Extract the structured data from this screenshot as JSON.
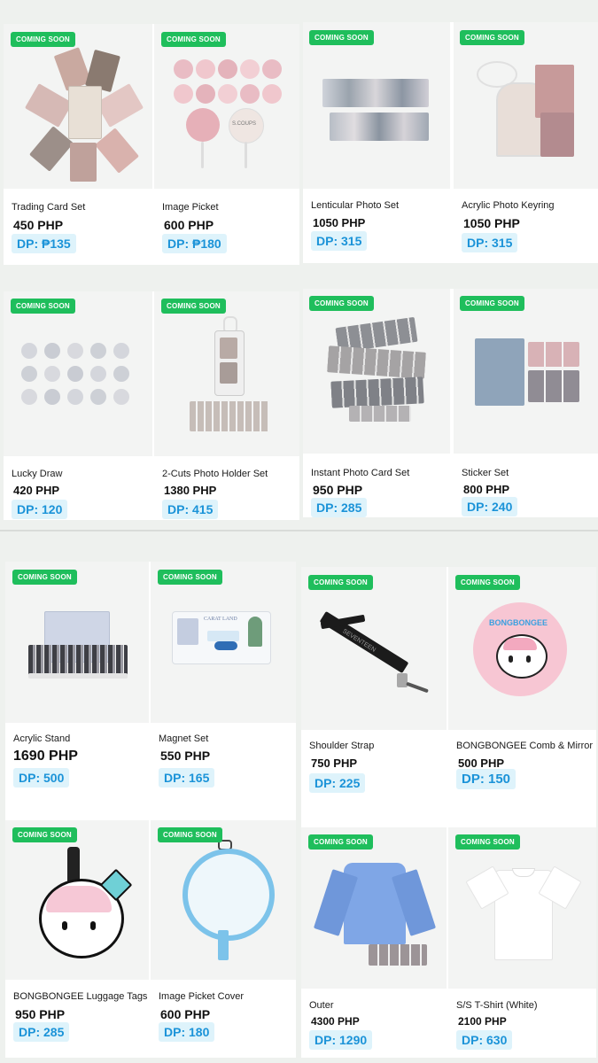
{
  "badge_label": "COMING SOON",
  "colors": {
    "badge": "#1fbe5c",
    "dp_bg": "#def3fb",
    "dp_text": "#1b93d8"
  },
  "products": [
    {
      "name": "Trading Card Set",
      "price": "450 PHP",
      "dp": "DP: ₱135"
    },
    {
      "name": "Image Picket",
      "price": "600 PHP",
      "dp": "DP: ₱180"
    },
    {
      "name": "Lenticular Photo Set",
      "price": "1050 PHP",
      "dp": "DP: 315"
    },
    {
      "name": "Acrylic Photo Keyring",
      "price": "1050 PHP",
      "dp": "DP: 315"
    },
    {
      "name": "Lucky Draw",
      "price": "420 PHP",
      "dp": "DP: 120"
    },
    {
      "name": "2-Cuts Photo Holder Set",
      "price": "1380 PHP",
      "dp": "DP: 415"
    },
    {
      "name": "Instant Photo Card Set",
      "price": "950 PHP",
      "dp": "DP: 285"
    },
    {
      "name": "Sticker Set",
      "price": "800 PHP",
      "dp": "DP: 240"
    },
    {
      "name": "Acrylic Stand",
      "price": "1690 PHP",
      "dp": "DP: 500"
    },
    {
      "name": "Magnet Set",
      "price": "550 PHP",
      "dp": "DP: 165"
    },
    {
      "name": "Shoulder Strap",
      "price": "750 PHP",
      "dp": "DP: 225"
    },
    {
      "name": "BONGBONGEE Comb & Mirror",
      "price": "500 PHP",
      "dp": "DP: 150"
    },
    {
      "name": "BONGBONGEE Luggage Tags",
      "price": "950 PHP",
      "dp": "DP: 285"
    },
    {
      "name": "Image Picket Cover",
      "price": "600 PHP",
      "dp": "DP: 180"
    },
    {
      "name": "Outer",
      "price": "4300 PHP",
      "dp": "DP: 1290"
    },
    {
      "name": "S/S T-Shirt (White)",
      "price": "2100 PHP",
      "dp": "DP: 630"
    }
  ],
  "artwork_text": {
    "picket_logo": "S.COUPS",
    "carat_land": "CARAT LAND",
    "strap_text": "SEVENTEEN",
    "bongbongee": "BONGBONGEE"
  }
}
